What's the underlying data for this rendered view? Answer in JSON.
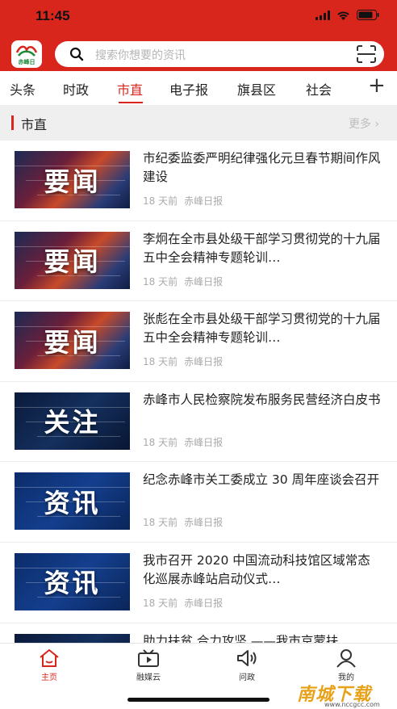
{
  "status_bar": {
    "time": "11:45"
  },
  "app": {
    "logo_text": "赤峰日",
    "brand_color": "#d8261d"
  },
  "search": {
    "placeholder": "搜索你想要的资讯"
  },
  "tabs": [
    "头条",
    "时政",
    "市直",
    "电子报",
    "旗县区",
    "社会"
  ],
  "active_tab": "市直",
  "section": {
    "title": "市直",
    "more": "更多"
  },
  "news": [
    {
      "title": "市纪委监委严明纪律强化元旦春节期间作风建设",
      "time": "18 天前",
      "source": "赤峰日报",
      "thumb_label": "要闻",
      "thumb_style": "red"
    },
    {
      "title": "李炯在全市县处级干部学习贯彻党的十九届五中全会精神专题轮训…",
      "time": "18 天前",
      "source": "赤峰日报",
      "thumb_label": "要闻",
      "thumb_style": "red"
    },
    {
      "title": "张彪在全市县处级干部学习贯彻党的十九届五中全会精神专题轮训…",
      "time": "18 天前",
      "source": "赤峰日报",
      "thumb_label": "要闻",
      "thumb_style": "red"
    },
    {
      "title": "赤峰市人民检察院发布服务民营经济白皮书",
      "time": "18 天前",
      "source": "赤峰日报",
      "thumb_label": "关注",
      "thumb_style": "navy"
    },
    {
      "title": "纪念赤峰市关工委成立 30 周年座谈会召开",
      "time": "18 天前",
      "source": "赤峰日报",
      "thumb_label": "资讯",
      "thumb_style": "blue"
    },
    {
      "title": "我市召开 2020 中国流动科技馆区域常态化巡展赤峰站启动仪式…",
      "time": "18 天前",
      "source": "赤峰日报",
      "thumb_label": "资讯",
      "thumb_style": "blue"
    },
    {
      "title": "助力扶贫 合力攻坚 ——我市京蒙扶",
      "time": "",
      "source": "",
      "thumb_label": "",
      "thumb_style": "navy"
    }
  ],
  "bottom_nav": [
    {
      "label": "主页",
      "icon": "home-icon",
      "active": true
    },
    {
      "label": "融媒云",
      "icon": "video-icon",
      "active": false
    },
    {
      "label": "问政",
      "icon": "speaker-icon",
      "active": false
    },
    {
      "label": "我的",
      "icon": "user-icon",
      "active": false
    }
  ],
  "watermark": {
    "text": "南城下载",
    "sub": "www.nccgcc.com"
  }
}
